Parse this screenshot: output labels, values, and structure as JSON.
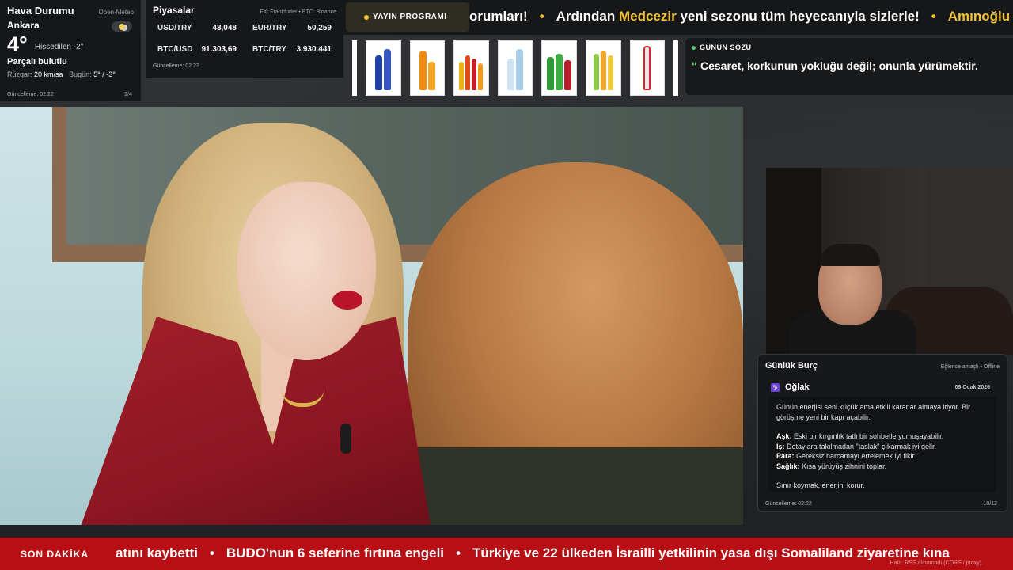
{
  "weather": {
    "title": "Hava Durumu",
    "source": "Open-Meteo",
    "city": "Ankara",
    "temperature": "4°",
    "feels_like": "Hissedilen -2°",
    "condition": "Parçalı bulutlu",
    "wind_label": "Rüzgar:",
    "wind_value": "20 km/sa",
    "today_label": "Bugün:",
    "today_value": "5° / -3°",
    "updated": "Güncelleme: 02:22",
    "page": "2/4",
    "icon": "partly-cloudy-icon"
  },
  "markets": {
    "title": "Piyasalar",
    "source": "FX: Frankfurter • BTC: Binance",
    "items": [
      {
        "label": "USD/TRY",
        "value": "43,048"
      },
      {
        "label": "EUR/TRY",
        "value": "50,259"
      },
      {
        "label": "BTC/USD",
        "value": "91.303,69"
      },
      {
        "label": "BTC/TRY",
        "value": "3.930.441"
      }
    ],
    "updated": "Güncelleme: 02:22"
  },
  "top_ticker": {
    "tag": "YAYIN PROGRAMI",
    "segment1": "orumları!",
    "segment2_pre": "Ardından ",
    "segment2_highlight": "Medcezir",
    "segment2_post": " yeni sezonu tüm heyecanıyla sizlerle!",
    "segment3_highlight": "Amınoğlu",
    "separator": "•",
    "accent_color": "#f2c230"
  },
  "quote": {
    "title": "GÜNÜN SÖZÜ",
    "mark": "“",
    "text": "Cesaret, korkunun yokluğu değil; onunla yürümektir."
  },
  "horoscope": {
    "title": "Günlük Burç",
    "status": "Eğlence amaçlı • Offline",
    "sign_icon": "♑",
    "sign": "Oğlak",
    "date": "09 Ocak 2026",
    "intro": "Günün enerjisi seni küçük ama etkili kararlar almaya itiyor. Bir görüşme yeni bir kapı açabilir.",
    "love_label": "Aşk:",
    "love": " Eski bir kırgınlık tatlı bir sohbetle yumuşayabilir.",
    "work_label": "İş:",
    "work": " Detaylara takılmadan \"taslak\" çıkarmak iyi gelir.",
    "money_label": "Para:",
    "money": " Gereksiz harcamayı ertelemek iyi fikir.",
    "health_label": "Sağlık:",
    "health": " Kısa yürüyüş zihnini toplar.",
    "closing": "Sınır koymak, enerjini korur.",
    "updated": "Güncelleme: 02:22",
    "page": "10/12"
  },
  "breaking": {
    "label": "SON DAKİKA",
    "item1": "atını kaybetti",
    "item2": "BUDO'nun 6 seferine fırtına engeli",
    "item3": "Türkiye ve 22 ülkeden İsrailli yetkilinin yasa dışı Somaliland ziyaretine kına",
    "separator": "•",
    "note": "Hata: RSS alınamadı (CORS / proxy).",
    "color": "#b80f14"
  },
  "products": {
    "icons": [
      "blue-bottles-product",
      "orange-soda-product",
      "mixed-soda-product",
      "water-bottles-product",
      "green-soda-product",
      "fruit-soda-product",
      "red-bottle-product"
    ]
  }
}
